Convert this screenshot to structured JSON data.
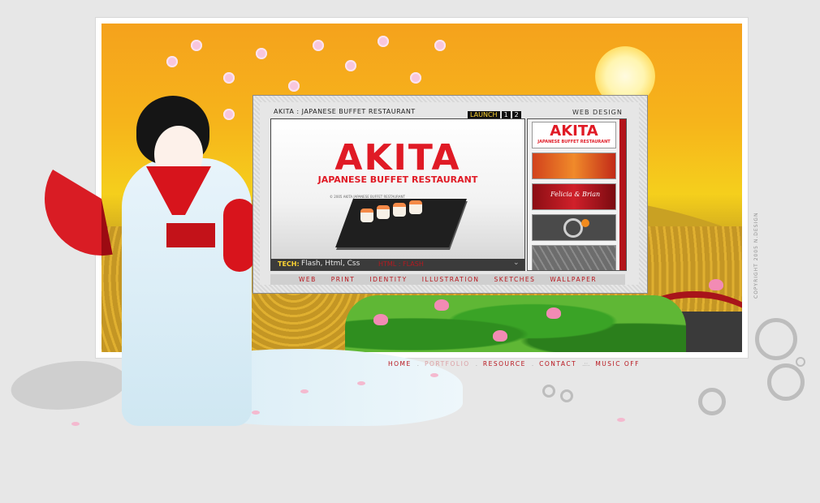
{
  "project": {
    "title": "AKITA : JAPANESE BUFFET RESTAURANT",
    "launch_label": "LAUNCH",
    "launch_links": [
      "1",
      "2"
    ],
    "category": "WEB DESIGN"
  },
  "preview": {
    "brand": "AKITA",
    "subtitle": "JAPANESE BUFFET RESTAURANT",
    "fine_print": "© 2005 AKITA JAPANESE BUFFET RESTAURANT",
    "tech_label": "TECH:",
    "tech_value": "Flash, Html, Css",
    "tech_mode": "HTML : FLASH",
    "expand_icon": "chevron-double-down-icon"
  },
  "thumbnails": [
    {
      "name": "akita",
      "text": "AKITA",
      "subtext": "JAPANESE BUFFET RESTAURANT"
    },
    {
      "name": "people"
    },
    {
      "name": "wedding",
      "text": "Felicia & Brian"
    },
    {
      "name": "n-logo"
    },
    {
      "name": "hexagons"
    }
  ],
  "portfolio_nav": [
    "WEB",
    "PRINT",
    "IDENTITY",
    "ILLUSTRATION",
    "SKETCHES",
    "WALLPAPER"
  ],
  "footer_nav": {
    "items": [
      "HOME",
      "PORTFOLIO",
      "RESOURCE",
      "CONTACT",
      "MUSIC OFF"
    ],
    "separators": [
      ".",
      ".",
      ".",
      ".::."
    ],
    "current": "PORTFOLIO"
  },
  "copyright": "COPYRIGHT 2005 N.DESIGN",
  "colors": {
    "accent_red": "#b8141c",
    "brand_red": "#e01a25",
    "launch_yellow": "#fcd433",
    "background": "#e7e7e7"
  }
}
